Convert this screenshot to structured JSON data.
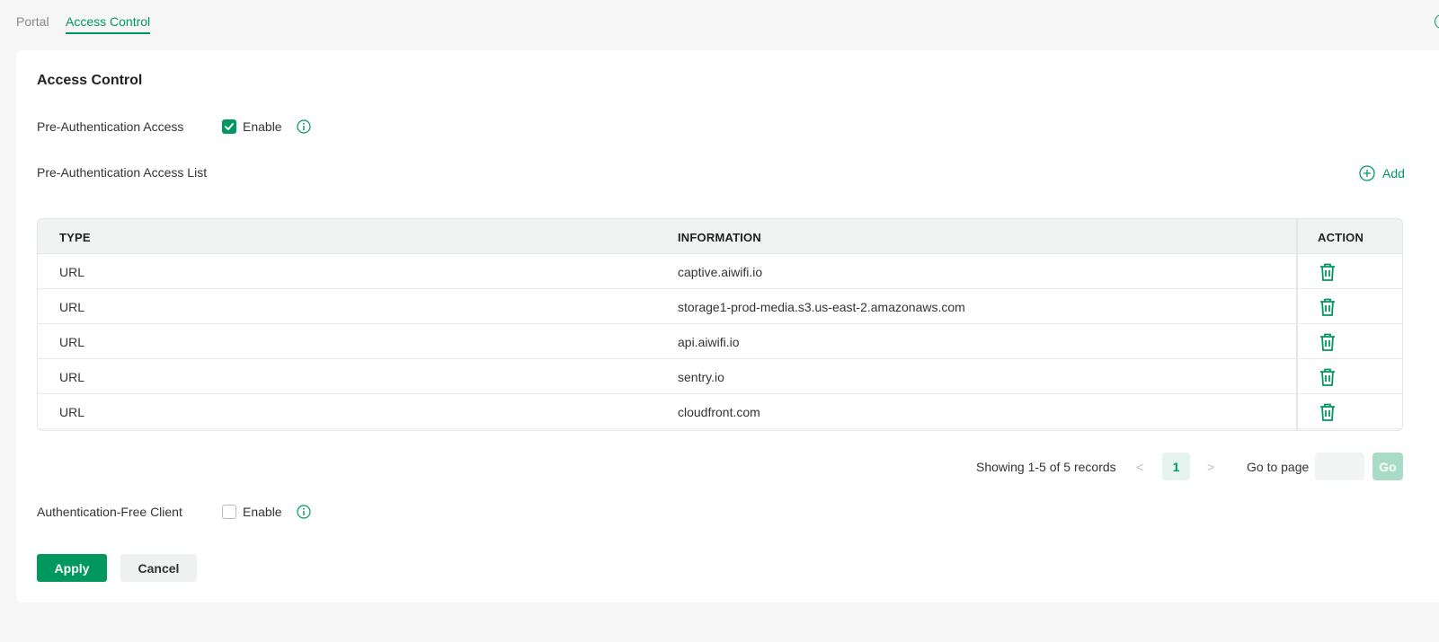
{
  "topnav": {
    "tabs": [
      {
        "label": "Portal",
        "active": false
      },
      {
        "label": "Access Control",
        "active": true
      }
    ]
  },
  "card": {
    "title": "Access Control",
    "pre_auth": {
      "label": "Pre-Authentication Access",
      "checked": true,
      "enable_label": "Enable"
    },
    "list": {
      "label": "Pre-Authentication Access List",
      "add_label": "Add"
    },
    "table": {
      "headers": {
        "type": "TYPE",
        "information": "INFORMATION",
        "action": "ACTION"
      },
      "rows": [
        {
          "type": "URL",
          "information": "captive.aiwifi.io"
        },
        {
          "type": "URL",
          "information": "storage1-prod-media.s3.us-east-2.amazonaws.com"
        },
        {
          "type": "URL",
          "information": "api.aiwifi.io"
        },
        {
          "type": "URL",
          "information": "sentry.io"
        },
        {
          "type": "URL",
          "information": "cloudfront.com"
        }
      ]
    },
    "pagination": {
      "showing": "Showing 1-5 of 5 records",
      "prev": "<",
      "current_page": "1",
      "next": ">",
      "goto_label": "Go to page",
      "goto_value": "",
      "go_label": "Go"
    },
    "auth_free": {
      "label": "Authentication-Free Client",
      "checked": false,
      "enable_label": "Enable"
    },
    "buttons": {
      "apply": "Apply",
      "cancel": "Cancel"
    }
  },
  "colors": {
    "accent": "#00985e",
    "accent_light": "#e5f4ee",
    "go_disabled": "#a8dcc6"
  }
}
